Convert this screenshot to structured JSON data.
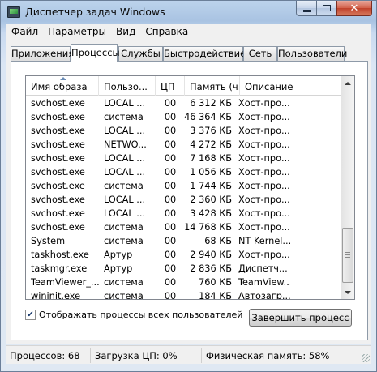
{
  "window": {
    "title": "Диспетчер задач Windows"
  },
  "menu": [
    "Файл",
    "Параметры",
    "Вид",
    "Справка"
  ],
  "tabs": [
    "Приложения",
    "Процессы",
    "Службы",
    "Быстродействие",
    "Сеть",
    "Пользователи"
  ],
  "active_tab": "Процессы",
  "columns": [
    "Имя образа",
    "Пользо...",
    "ЦП",
    "Память (ч...",
    "Описание"
  ],
  "sort_column": "Имя образа",
  "rows": [
    [
      "svchost.exe",
      "LOCAL ...",
      "00",
      "6 312 КБ",
      "Хост-про..."
    ],
    [
      "svchost.exe",
      "система",
      "00",
      "46 364 КБ",
      "Хост-про..."
    ],
    [
      "svchost.exe",
      "LOCAL ...",
      "00",
      "3 376 КБ",
      "Хост-про..."
    ],
    [
      "svchost.exe",
      "NETWO...",
      "00",
      "4 272 КБ",
      "Хост-про..."
    ],
    [
      "svchost.exe",
      "LOCAL ...",
      "00",
      "7 168 КБ",
      "Хост-про..."
    ],
    [
      "svchost.exe",
      "LOCAL ...",
      "00",
      "1 056 КБ",
      "Хост-про..."
    ],
    [
      "svchost.exe",
      "система",
      "00",
      "1 744 КБ",
      "Хост-про..."
    ],
    [
      "svchost.exe",
      "LOCAL ...",
      "00",
      "2 360 КБ",
      "Хост-про..."
    ],
    [
      "svchost.exe",
      "LOCAL ...",
      "00",
      "3 428 КБ",
      "Хост-про..."
    ],
    [
      "svchost.exe",
      "система",
      "00",
      "14 768 КБ",
      "Хост-про..."
    ],
    [
      "System",
      "система",
      "00",
      "68 КБ",
      "NT Kernel..."
    ],
    [
      "taskhost.exe",
      "Артур",
      "00",
      "2 940 КБ",
      "Хост-про..."
    ],
    [
      "taskmgr.exe",
      "Артур",
      "00",
      "2 836 КБ",
      "Диспетч..."
    ],
    [
      "TeamViewer_...",
      "система",
      "00",
      "760 КБ",
      "TeamView..."
    ],
    [
      "wininit.exe",
      "система",
      "00",
      "184 КБ",
      "Автозагр..."
    ]
  ],
  "show_all_users": {
    "label": "Отображать процессы всех пользователей",
    "checked": true
  },
  "end_process_label": "Завершить процесс",
  "status": {
    "processes": "Процессов: 68",
    "cpu": "Загрузка ЦП: 0%",
    "memory": "Физическая память: 58%"
  },
  "colors": {
    "title_bar": "#bcd3ec",
    "close_button": "#c0412a",
    "panel": "#f0f0f0"
  }
}
